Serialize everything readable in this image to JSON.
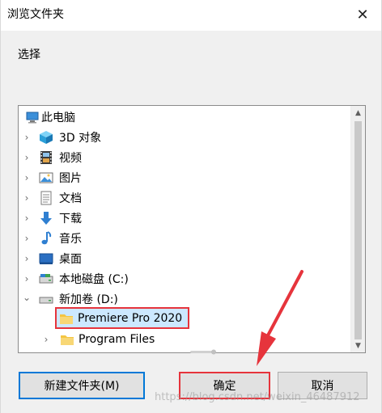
{
  "window": {
    "title": "浏览文件夹",
    "close_glyph": "✕"
  },
  "prompt": "选择",
  "tree": {
    "items": [
      {
        "label": "此电脑",
        "icon": "computer-icon",
        "chevron": ""
      },
      {
        "label": "3D 对象",
        "icon": "3d-objects-icon",
        "chevron": "›"
      },
      {
        "label": "视频",
        "icon": "videos-icon",
        "chevron": "›"
      },
      {
        "label": "图片",
        "icon": "pictures-icon",
        "chevron": "›"
      },
      {
        "label": "文档",
        "icon": "documents-icon",
        "chevron": "›"
      },
      {
        "label": "下载",
        "icon": "downloads-icon",
        "chevron": "›"
      },
      {
        "label": "音乐",
        "icon": "music-icon",
        "chevron": "›"
      },
      {
        "label": "桌面",
        "icon": "desktop-icon",
        "chevron": "›"
      },
      {
        "label": "本地磁盘 (C:)",
        "icon": "drive-c-icon",
        "chevron": "›"
      },
      {
        "label": "新加卷 (D:)",
        "icon": "drive-d-icon",
        "chevron": "⌄"
      },
      {
        "label": "Premiere Pro 2020",
        "icon": "folder-icon",
        "chevron": ""
      },
      {
        "label": "Program Files",
        "icon": "folder-icon",
        "chevron": "›"
      }
    ]
  },
  "buttons": {
    "new_folder": "新建文件夹(M)",
    "ok": "确定",
    "cancel": "取消"
  },
  "watermark": "https://blog.csdn.net/weixin_46487912",
  "colors": {
    "highlight_red": "#e6343c",
    "selection_blue": "#cce8ff",
    "focus_blue": "#0078d7"
  }
}
